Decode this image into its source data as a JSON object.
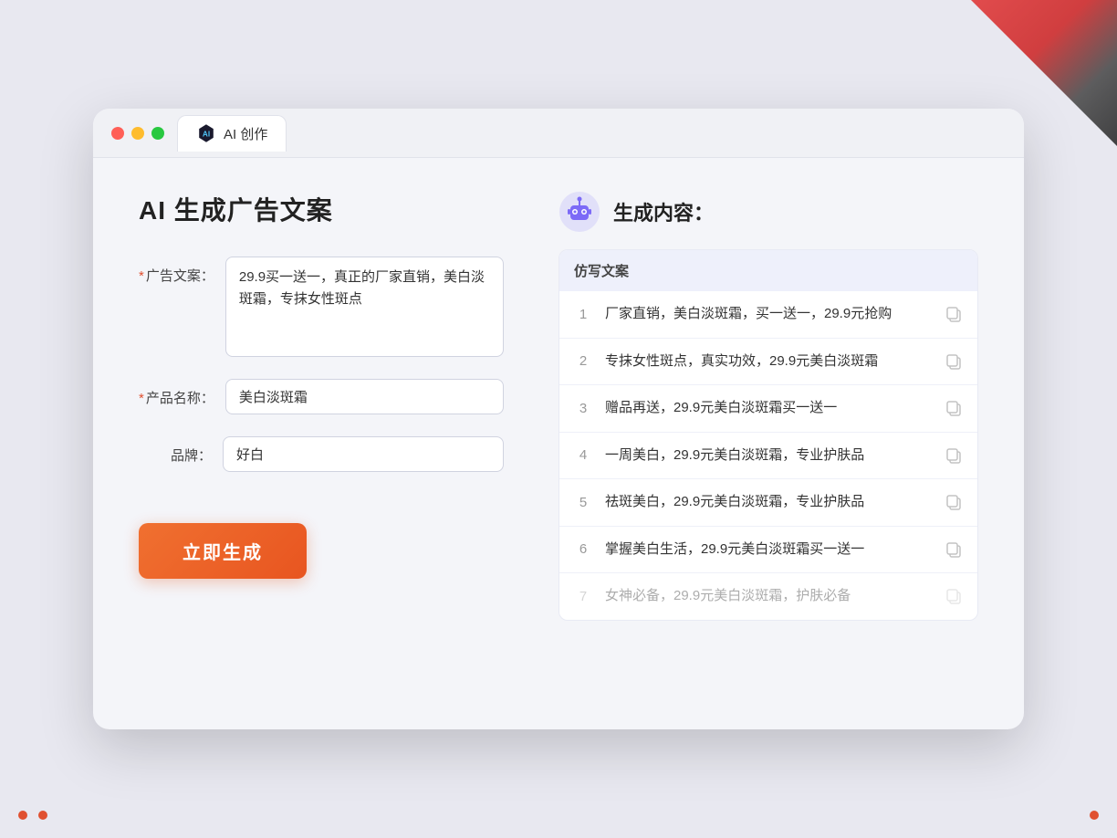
{
  "browser": {
    "tab_label": "AI 创作",
    "traffic_lights": [
      "red",
      "yellow",
      "green"
    ]
  },
  "page": {
    "title": "AI 生成广告文案",
    "right_title": "生成内容："
  },
  "form": {
    "ad_copy_label": "广告文案：",
    "ad_copy_required": true,
    "ad_copy_value": "29.9买一送一，真正的厂家直销，美白淡斑霜，专抹女性斑点",
    "product_name_label": "产品名称：",
    "product_name_required": true,
    "product_name_value": "美白淡斑霜",
    "brand_label": "品牌：",
    "brand_required": false,
    "brand_value": "好白",
    "generate_button_label": "立即生成"
  },
  "results": {
    "table_header": "仿写文案",
    "items": [
      {
        "number": 1,
        "text": "厂家直销，美白淡斑霜，买一送一，29.9元抢购"
      },
      {
        "number": 2,
        "text": "专抹女性斑点，真实功效，29.9元美白淡斑霜"
      },
      {
        "number": 3,
        "text": "赠品再送，29.9元美白淡斑霜买一送一"
      },
      {
        "number": 4,
        "text": "一周美白，29.9元美白淡斑霜，专业护肤品"
      },
      {
        "number": 5,
        "text": "祛斑美白，29.9元美白淡斑霜，专业护肤品"
      },
      {
        "number": 6,
        "text": "掌握美白生活，29.9元美白淡斑霜买一送一"
      },
      {
        "number": 7,
        "text": "女神必备，29.9元美白淡斑霜，护肤必备",
        "faded": true
      }
    ]
  }
}
